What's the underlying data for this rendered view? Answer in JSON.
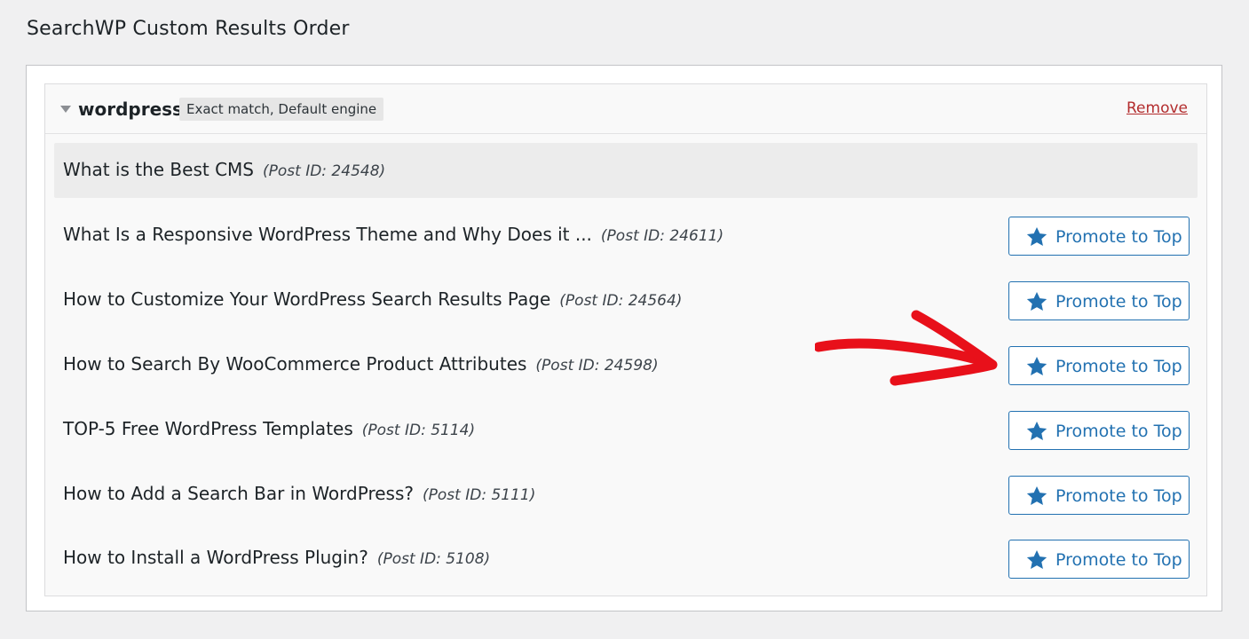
{
  "page": {
    "title": "SearchWP Custom Results Order"
  },
  "query": {
    "term": "wordpress",
    "badge": "Exact match, Default engine",
    "remove_label": "Remove"
  },
  "results": [
    {
      "title": "What is the Best CMS",
      "post_id": "(Post ID: 24548)",
      "promote_label": ""
    },
    {
      "title": "What Is a Responsive WordPress Theme and Why Does it ...",
      "post_id": "(Post ID: 24611)",
      "promote_label": "Promote to Top"
    },
    {
      "title": "How to Customize Your WordPress Search Results Page",
      "post_id": "(Post ID: 24564)",
      "promote_label": "Promote to Top"
    },
    {
      "title": "How to Search By WooCommerce Product Attributes",
      "post_id": "(Post ID: 24598)",
      "promote_label": "Promote to Top"
    },
    {
      "title": "TOP-5 Free WordPress Templates",
      "post_id": "(Post ID: 5114)",
      "promote_label": "Promote to Top"
    },
    {
      "title": "How to Add a Search Bar in WordPress?",
      "post_id": "(Post ID: 5111)",
      "promote_label": "Promote to Top"
    },
    {
      "title": "How to Install a WordPress Plugin?",
      "post_id": "(Post ID: 5108)",
      "promote_label": "Promote to Top"
    }
  ],
  "icons": {
    "caret": "caret-down-icon",
    "promote": "star-icon",
    "annotation": "red-arrow-icon"
  },
  "colors": {
    "accent": "#2271b1",
    "remove": "#b32d2e",
    "annotation_arrow": "#e8101a"
  }
}
